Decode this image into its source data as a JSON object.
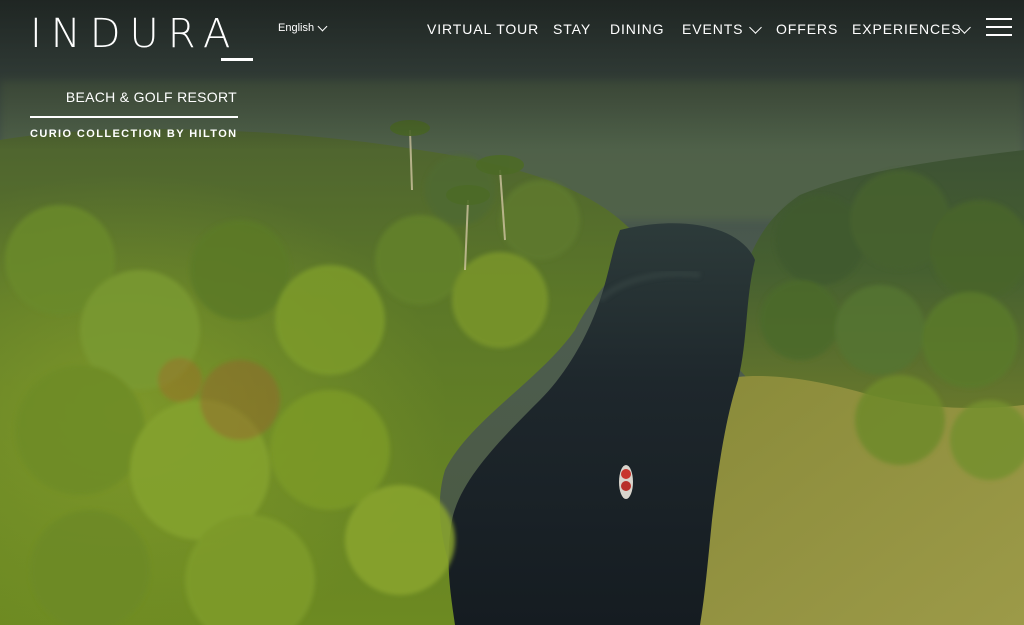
{
  "logo": {
    "name": "INDURA",
    "subtitle": "BEACH & GOLF RESORT",
    "collection": "CURIO COLLECTION BY HILTON"
  },
  "language": {
    "label": "English"
  },
  "nav": {
    "items": [
      {
        "label": "VIRTUAL TOUR",
        "has_dropdown": false
      },
      {
        "label": "STAY",
        "has_dropdown": false
      },
      {
        "label": "DINING",
        "has_dropdown": false
      },
      {
        "label": "EVENTS",
        "has_dropdown": true
      },
      {
        "label": "OFFERS",
        "has_dropdown": false
      },
      {
        "label": "EXPERIENCES",
        "has_dropdown": true
      }
    ]
  },
  "icons": {
    "menu": "hamburger-menu-icon",
    "dropdown": "chevron-down-icon"
  },
  "colors": {
    "text": "#ffffff",
    "jungle": "#5f7a26",
    "river": "#1c242b"
  }
}
